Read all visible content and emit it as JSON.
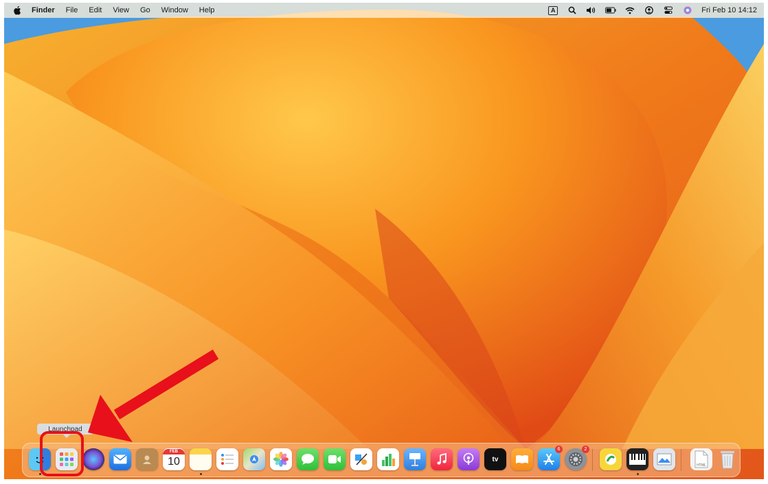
{
  "menubar": {
    "app_name": "Finder",
    "items": [
      "File",
      "Edit",
      "View",
      "Go",
      "Window",
      "Help"
    ],
    "input_source": "A",
    "clock": "Fri Feb 10  14:12",
    "status_icons": [
      "keyboard-input-icon",
      "search-icon",
      "volume-icon",
      "battery-icon",
      "wifi-icon",
      "user-icon",
      "control-center-icon",
      "siri-icon"
    ]
  },
  "tooltip": {
    "text": "Launchpad"
  },
  "dock": {
    "calendar": {
      "month": "FEB",
      "day": "10"
    },
    "appletv_label": "tv",
    "appstore_badge": "6",
    "settings_badge": "2",
    "html_file_label": "HTML",
    "apps": [
      "Finder",
      "Launchpad",
      "Siri",
      "Mail",
      "Contacts",
      "Calendar",
      "Notes",
      "Reminders",
      "Maps",
      "Photos",
      "Messages",
      "FaceTime",
      "Freeform",
      "Numbers",
      "Keynote",
      "Music",
      "Podcasts",
      "TV",
      "Books",
      "App Store",
      "System Settings",
      "Karabiner",
      "Piano",
      "Preview",
      "HTML File",
      "Trash"
    ]
  },
  "colors": {
    "highlight": "#e8101a",
    "arrow": "#e8101a"
  }
}
